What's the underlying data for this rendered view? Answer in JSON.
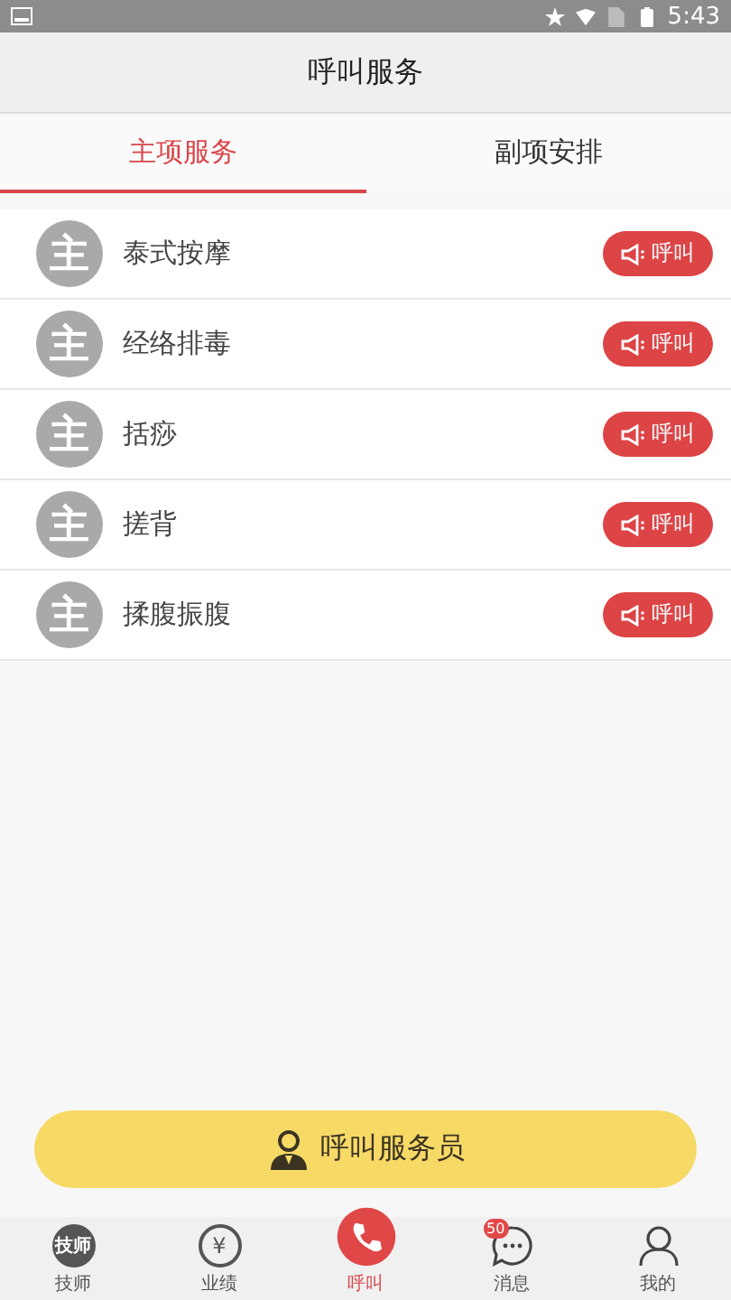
{
  "status_bar": {
    "time": "5:43"
  },
  "header": {
    "title": "呼叫服务"
  },
  "tabs": [
    {
      "label": "主项服务",
      "selected": true
    },
    {
      "label": "副项安排",
      "selected": false
    }
  ],
  "services": [
    {
      "avatar_text": "主",
      "name": "泰式按摩",
      "button": "呼叫"
    },
    {
      "avatar_text": "主",
      "name": "经络排毒",
      "button": "呼叫"
    },
    {
      "avatar_text": "主",
      "name": "括痧",
      "button": "呼叫"
    },
    {
      "avatar_text": "主",
      "name": "搓背",
      "button": "呼叫"
    },
    {
      "avatar_text": "主",
      "name": "揉腹振腹",
      "button": "呼叫"
    }
  ],
  "call_button": {
    "label": "呼叫服务员"
  },
  "nav": [
    {
      "kind": "badge",
      "icon_text": "技师",
      "label": "技师",
      "selected": false
    },
    {
      "kind": "yen",
      "icon_text": "¥",
      "label": "业绩",
      "selected": false
    },
    {
      "kind": "phone",
      "label": "呼叫",
      "selected": true
    },
    {
      "kind": "chat",
      "badge": "50",
      "label": "消息",
      "selected": false
    },
    {
      "kind": "person",
      "label": "我的",
      "selected": false
    }
  ]
}
